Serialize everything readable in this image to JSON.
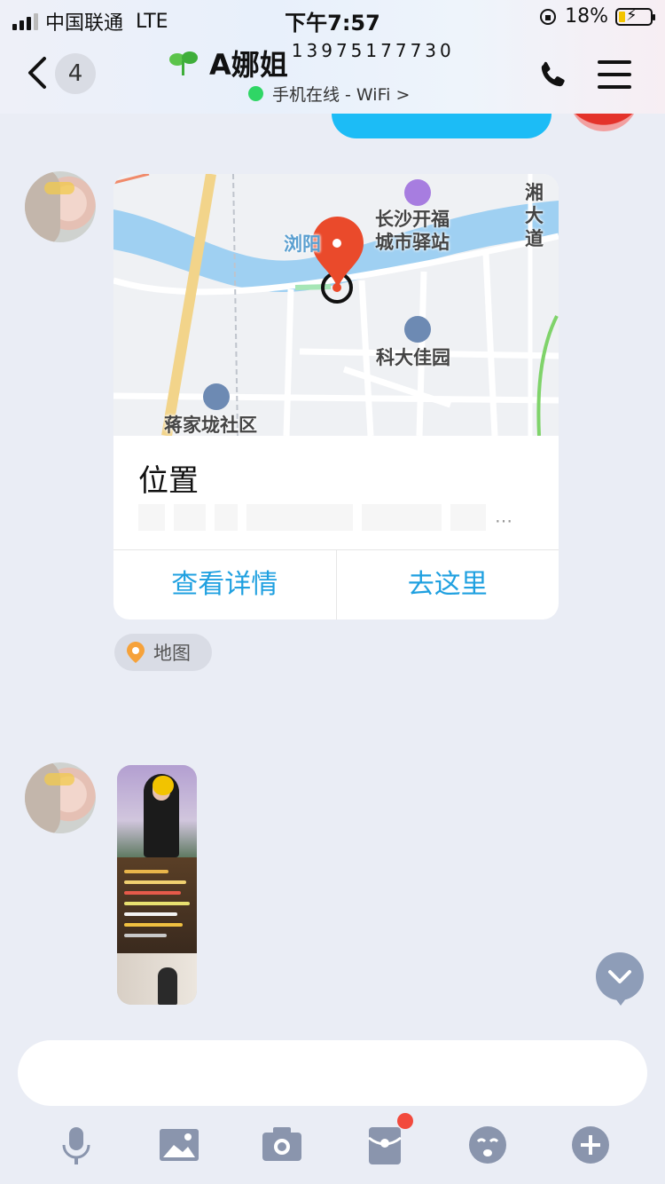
{
  "status_bar": {
    "carrier": "中国联通",
    "network": "LTE",
    "time": "下午7:57",
    "battery": "18%",
    "battery_level": 0.18
  },
  "header": {
    "unread_count": "4",
    "contact_name": "A娜姐",
    "contact_extra": "13975177730",
    "online_status": "手机在线 - WiFi >"
  },
  "location_card": {
    "map_labels": {
      "river": "浏阳",
      "hotel": "长沙开福\n城市驿站",
      "road": "湘大道",
      "community1": "科大佳园",
      "community2": "蒋家垅社区"
    },
    "title": "位置",
    "address": "…",
    "details_button": "查看详情",
    "navigate_button": "去这里"
  },
  "map_tag": "地图",
  "input": {
    "value": "",
    "placeholder": ""
  },
  "colors": {
    "accent_blue": "#1fa0e0",
    "bubble_blue": "#1cbcf6",
    "background": "#eaedf5",
    "online_green": "#2fd665",
    "notification_red": "#f24a3d"
  },
  "toolbar_icons": [
    "microphone-icon",
    "image-icon",
    "camera-icon",
    "red-packet-icon",
    "emoji-icon",
    "plus-icon"
  ]
}
